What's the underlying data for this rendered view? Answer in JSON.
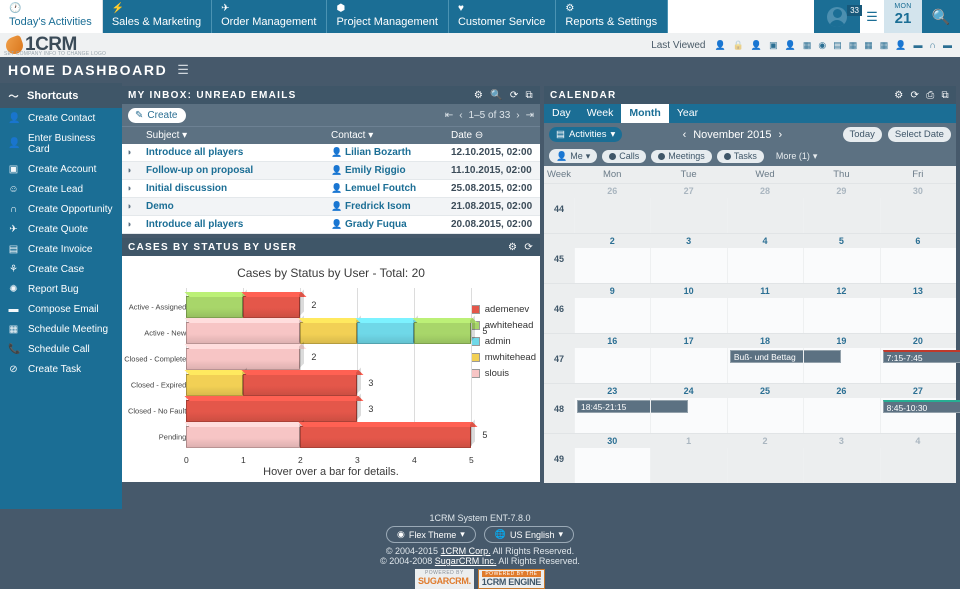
{
  "topnav": {
    "modules": [
      {
        "label": "Today's Activities",
        "icon": "clock-icon",
        "active": true
      },
      {
        "label": "Sales & Marketing",
        "icon": "bolt-icon",
        "active": false
      },
      {
        "label": "Order Management",
        "icon": "paper-plane-icon",
        "active": false
      },
      {
        "label": "Project Management",
        "icon": "box-icon",
        "active": false
      },
      {
        "label": "Customer Service",
        "icon": "heart-icon",
        "active": false
      },
      {
        "label": "Reports & Settings",
        "icon": "gear-icon",
        "active": false
      }
    ],
    "user_badge": "33",
    "date_day": "MON",
    "date_num": "21",
    "menu_icon": "hamburger-icon",
    "search_icon": "search-icon",
    "avatar_icon": "user-avatar-icon"
  },
  "logobar": {
    "brand": "1CRM",
    "tagline": "SET COMPANY INFO TO CHANGE LOGO",
    "last_viewed_label": "Last Viewed",
    "last_viewed_icons": [
      "contact-icon",
      "lock-icon",
      "contact-icon",
      "account-icon",
      "contact-icon",
      "meeting-icon",
      "lead-icon",
      "invoice-icon",
      "meeting-icon",
      "meeting-icon",
      "meeting-icon",
      "contact-icon",
      "email-icon",
      "opportunity-icon",
      "email-icon"
    ]
  },
  "page": {
    "title": "HOME DASHBOARD",
    "menu_icon": "hamburger-icon"
  },
  "sidebar": {
    "header": "Shortcuts",
    "header_icon": "chart-line-icon",
    "items": [
      {
        "label": "Create Contact",
        "icon": "contact-icon"
      },
      {
        "label": "Enter Business Card",
        "icon": "card-icon"
      },
      {
        "label": "Create Account",
        "icon": "account-icon"
      },
      {
        "label": "Create Lead",
        "icon": "lead-icon"
      },
      {
        "label": "Create Opportunity",
        "icon": "opportunity-icon"
      },
      {
        "label": "Create Quote",
        "icon": "quote-icon"
      },
      {
        "label": "Create Invoice",
        "icon": "invoice-icon"
      },
      {
        "label": "Create Case",
        "icon": "case-icon"
      },
      {
        "label": "Report Bug",
        "icon": "bug-icon"
      },
      {
        "label": "Compose Email",
        "icon": "email-icon"
      },
      {
        "label": "Schedule Meeting",
        "icon": "meeting-icon"
      },
      {
        "label": "Schedule Call",
        "icon": "phone-icon"
      },
      {
        "label": "Create Task",
        "icon": "task-icon"
      }
    ]
  },
  "inbox": {
    "title": "MY INBOX: UNREAD EMAILS",
    "panel_icons": [
      "gear-icon",
      "search-icon",
      "refresh-icon",
      "expand-icon"
    ],
    "create_label": "Create",
    "create_icon": "pencil-icon",
    "pager_text": "1–5 of 33",
    "columns": [
      "",
      "Subject",
      "Contact",
      "Date"
    ],
    "rows": [
      {
        "subject": "Introduce all players",
        "contact": "Lilian Bozarth",
        "date": "12.10.2015, 02:00"
      },
      {
        "subject": "Follow-up on proposal",
        "contact": "Emily Riggio",
        "date": "11.10.2015, 02:00"
      },
      {
        "subject": "Initial discussion",
        "contact": "Lemuel Foutch",
        "date": "25.08.2015, 02:00"
      },
      {
        "subject": "Demo",
        "contact": "Fredrick Isom",
        "date": "21.08.2015, 02:00"
      },
      {
        "subject": "Introduce all players",
        "contact": "Grady Fuqua",
        "date": "20.08.2015, 02:00"
      }
    ]
  },
  "cases_panel": {
    "title": "CASES BY STATUS BY USER",
    "panel_icons": [
      "gear-icon",
      "refresh-icon"
    ]
  },
  "chart_data": {
    "type": "bar",
    "orientation": "horizontal",
    "stacked": true,
    "title": "Cases by Status by User - Total: 20",
    "xlabel": "Hover over a bar for details.",
    "ylabel": "",
    "xlim": [
      0,
      5
    ],
    "xticks": [
      0,
      1,
      2,
      3,
      4,
      5
    ],
    "grid": true,
    "legend_position": "right",
    "categories": [
      "Active - Assigned",
      "Active - New",
      "Closed - Complete",
      "Closed - Expired",
      "Closed - No Fault",
      "Pending"
    ],
    "totals": [
      2,
      5,
      2,
      3,
      3,
      5
    ],
    "series": [
      {
        "name": "ademenev",
        "color": "#e4574a",
        "values": [
          1,
          0,
          0,
          2,
          3,
          3
        ]
      },
      {
        "name": "awhitehead",
        "color": "#a8d66a",
        "values": [
          1,
          1,
          0,
          0,
          0,
          0
        ]
      },
      {
        "name": "admin",
        "color": "#6fd8e8",
        "values": [
          0,
          1,
          0,
          0,
          0,
          0
        ]
      },
      {
        "name": "mwhitehead",
        "color": "#f2d055",
        "values": [
          0,
          1,
          0,
          1,
          0,
          0
        ]
      },
      {
        "name": "slouis",
        "color": "#f7c5c5",
        "values": [
          0,
          2,
          2,
          0,
          0,
          2
        ]
      }
    ],
    "stack_order": [
      [
        "slouis",
        "mwhitehead",
        "admin",
        "awhitehead",
        "ademenev"
      ]
    ]
  },
  "calendar": {
    "title": "CALENDAR",
    "panel_icons": [
      "gear-icon",
      "refresh-icon",
      "print-icon",
      "expand-icon"
    ],
    "tabs": [
      {
        "label": "Day",
        "active": false
      },
      {
        "label": "Week",
        "active": false
      },
      {
        "label": "Month",
        "active": true
      },
      {
        "label": "Year",
        "active": false
      }
    ],
    "activities_label": "Activities",
    "activities_icon": "calendar-icon",
    "month_label": "November 2015",
    "prev_icon": "chevron-left-icon",
    "next_icon": "chevron-right-icon",
    "today_label": "Today",
    "select_date_label": "Select Date",
    "filters": [
      {
        "label": "Me",
        "type": "person"
      },
      {
        "label": "Calls",
        "type": "dot"
      },
      {
        "label": "Meetings",
        "type": "dot"
      },
      {
        "label": "Tasks",
        "type": "dot"
      },
      {
        "label": "More (1)",
        "type": "more"
      }
    ],
    "headers": [
      "Week",
      "Mon",
      "Tue",
      "Wed",
      "Thu",
      "Fri"
    ],
    "weeks": [
      {
        "num": "44",
        "days": [
          {
            "n": "26",
            "out": true,
            "events": []
          },
          {
            "n": "27",
            "out": true,
            "events": []
          },
          {
            "n": "28",
            "out": true,
            "events": []
          },
          {
            "n": "29",
            "out": true,
            "events": []
          },
          {
            "n": "30",
            "out": true,
            "events": []
          }
        ]
      },
      {
        "num": "45",
        "days": [
          {
            "n": "2",
            "out": false,
            "events": []
          },
          {
            "n": "3",
            "out": false,
            "events": []
          },
          {
            "n": "4",
            "out": false,
            "events": []
          },
          {
            "n": "5",
            "out": false,
            "events": []
          },
          {
            "n": "6",
            "out": false,
            "events": []
          }
        ]
      },
      {
        "num": "46",
        "days": [
          {
            "n": "9",
            "out": false,
            "events": []
          },
          {
            "n": "10",
            "out": false,
            "events": []
          },
          {
            "n": "11",
            "out": false,
            "events": []
          },
          {
            "n": "12",
            "out": false,
            "events": []
          },
          {
            "n": "13",
            "out": false,
            "events": []
          }
        ]
      },
      {
        "num": "47",
        "days": [
          {
            "n": "16",
            "out": false,
            "events": []
          },
          {
            "n": "17",
            "out": false,
            "events": []
          },
          {
            "n": "18",
            "out": false,
            "events": [
              {
                "label": "Buß- und Bettag",
                "accent": "none",
                "wide": true
              }
            ]
          },
          {
            "n": "19",
            "out": false,
            "events": []
          },
          {
            "n": "20",
            "out": false,
            "events": [
              {
                "label": "7:15-7:45",
                "accent": "red",
                "wide": true
              }
            ]
          }
        ]
      },
      {
        "num": "48",
        "days": [
          {
            "n": "23",
            "out": false,
            "events": [
              {
                "label": "18:45-21:15",
                "accent": "none",
                "wide": true
              }
            ]
          },
          {
            "n": "24",
            "out": false,
            "events": []
          },
          {
            "n": "25",
            "out": false,
            "events": []
          },
          {
            "n": "26",
            "out": false,
            "events": []
          },
          {
            "n": "27",
            "out": false,
            "events": [
              {
                "label": "8:45-10:30",
                "accent": "green",
                "wide": true
              }
            ]
          }
        ]
      },
      {
        "num": "49",
        "days": [
          {
            "n": "30",
            "out": false,
            "events": []
          },
          {
            "n": "1",
            "out": true,
            "events": []
          },
          {
            "n": "2",
            "out": true,
            "events": []
          },
          {
            "n": "3",
            "out": true,
            "events": []
          },
          {
            "n": "4",
            "out": true,
            "events": []
          }
        ]
      }
    ]
  },
  "footer": {
    "version": "1CRM System ENT-7.8.0",
    "theme_button": "Flex Theme",
    "lang_button": "US English",
    "copyright1_pre": "© 2004-2015 ",
    "copyright1_link": "1CRM Corp.",
    "copyright1_post": " All Rights Reserved.",
    "copyright2_pre": "© 2004-2008 ",
    "copyright2_link": "SugarCRM Inc.",
    "copyright2_post": " All Rights Reserved.",
    "logo1_top": "POWERED BY",
    "logo1_main": "SUGARCRM.",
    "logo2_top": "POWERED BY THE",
    "logo2_main": "1CRM ENGINE"
  },
  "colors": {
    "accent": "#1b6e95",
    "panel_header": "#3f5668",
    "page_bg": "#46596b",
    "toolbar": "#5c7182"
  }
}
